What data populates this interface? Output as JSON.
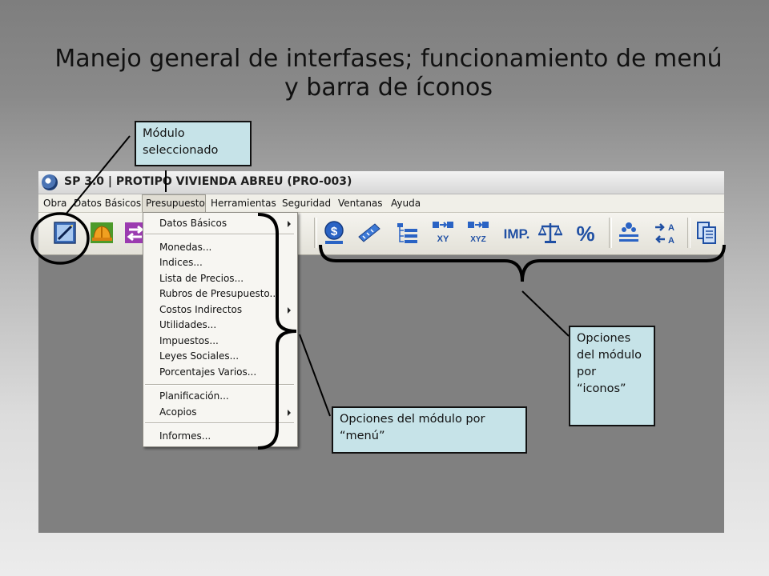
{
  "slide": {
    "title": "Manejo general de interfases; funcionamiento de menú y barra de íconos"
  },
  "window": {
    "title": "SP 3.0 | PROTIPO VIVIENDA ABREU (PRO-003)"
  },
  "menubar": {
    "items": [
      "Obra",
      "Datos Básicos",
      "Presupuesto",
      "Herramientas",
      "Seguridad",
      "Ventanas",
      "Ayuda"
    ],
    "active": "Presupuesto"
  },
  "dropdown": {
    "items": [
      {
        "label": "Datos Básicos",
        "submenu": true
      },
      {
        "label": "Monedas...",
        "submenu": false
      },
      {
        "label": "Indices...",
        "submenu": false
      },
      {
        "label": "Lista de Precios...",
        "submenu": false
      },
      {
        "label": "Rubros de Presupuesto...",
        "submenu": false
      },
      {
        "label": "Costos Indirectos",
        "submenu": true
      },
      {
        "label": "Utilidades...",
        "submenu": false
      },
      {
        "label": "Impuestos...",
        "submenu": false
      },
      {
        "label": "Leyes Sociales...",
        "submenu": false
      },
      {
        "label": "Porcentajes Varios...",
        "submenu": false
      },
      {
        "label": "Planificación...",
        "submenu": false
      },
      {
        "label": "Acopios",
        "submenu": true
      },
      {
        "label": "Informes...",
        "submenu": false
      }
    ]
  },
  "toolbar": {
    "icons": [
      "module-edit-icon",
      "hard-hat-icon",
      "transfer-icon",
      "money-bag-icon",
      "measure-icon",
      "list-tree-icon",
      "coordinates-xy-icon",
      "coordinates-xyz-icon",
      "tax-imp-icon",
      "balance-scale-icon",
      "percent-icon",
      "distribute-icon",
      "sort-az-icon",
      "copy-pages-icon"
    ],
    "imp_text": "IMP.",
    "xy_text": "XY",
    "xyz_text": "XYZ",
    "percent_text": "%"
  },
  "callouts": {
    "module_selected": "Módulo seleccionado",
    "menu_options": "Opciones del módulo por “menú”",
    "icon_options": "Opciones del módulo por “iconos”"
  },
  "colors": {
    "callout_bg": "#c6e3e8",
    "icon_blue": "#1f4fa3",
    "app_background": "#808080"
  }
}
